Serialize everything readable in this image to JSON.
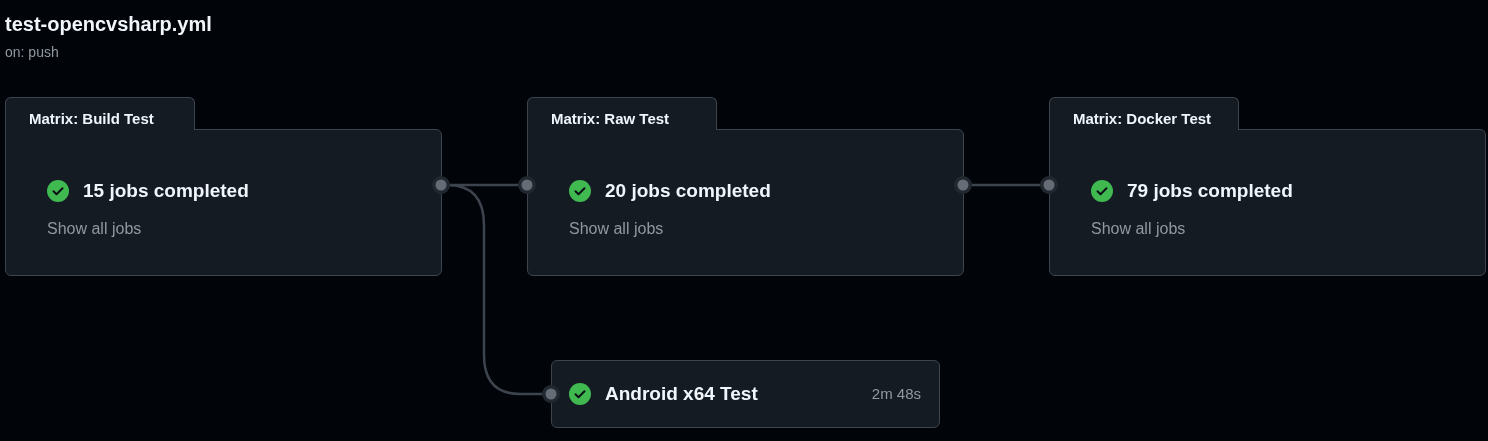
{
  "workflow": {
    "title": "test-opencvsharp.yml",
    "trigger": "on: push"
  },
  "matrix_jobs": [
    {
      "name": "Matrix: Build Test",
      "succeeded": true,
      "summary": "15 jobs completed",
      "link": "Show all jobs"
    },
    {
      "name": "Matrix: Raw Test",
      "succeeded": true,
      "summary": "20 jobs completed",
      "link": "Show all jobs"
    },
    {
      "name": "Matrix: Docker Test",
      "succeeded": true,
      "summary": "79 jobs completed",
      "link": "Show all jobs"
    }
  ],
  "jobs": [
    {
      "name": "Android x64 Test",
      "succeeded": true,
      "duration": "2m 48s"
    }
  ]
}
